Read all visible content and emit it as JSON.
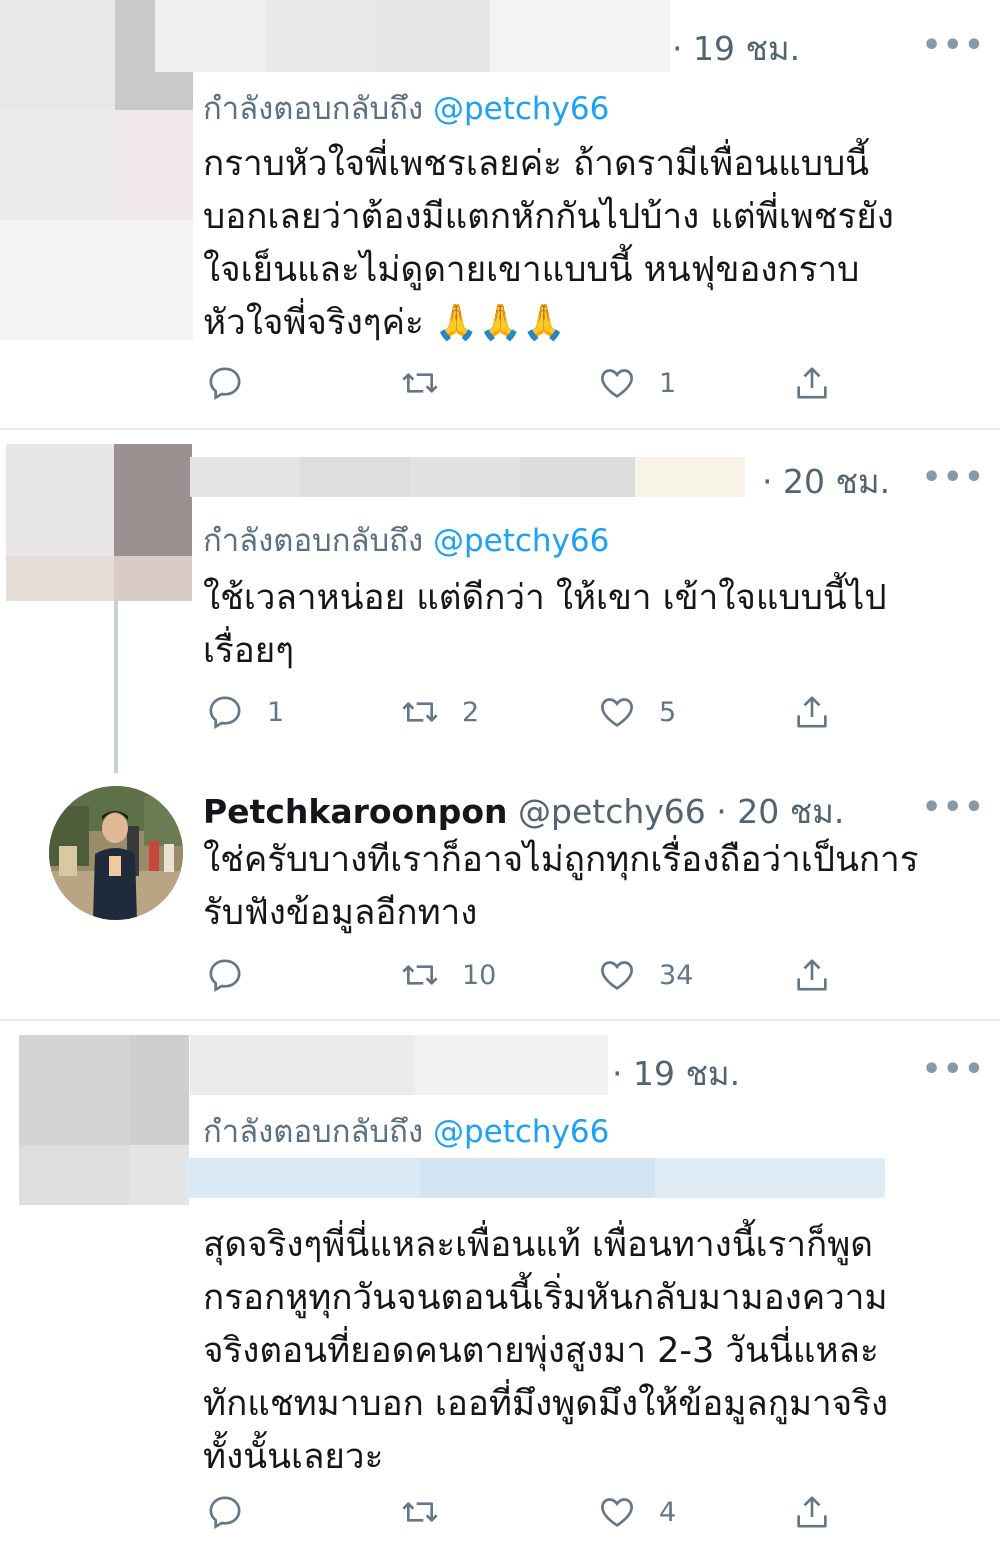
{
  "tweets": [
    {
      "time": "· 19 ชม.",
      "replying_prefix": "กำลังตอบกลับถึง",
      "replying_handle": "@petchy66",
      "lines": [
        "กราบหัวใจพี่เพชรเลยค่ะ ถ้าดรามีเพื่อนแบบนี้",
        "บอกเลยว่าต้องมีแตกหักกันไปบ้าง แต่พี่เพชรยัง",
        "ใจเย็นและไม่ดูดายเขาแบบนี้ หนฟุของกราบ",
        "หัวใจพี่จริงๆค่ะ 🙏🙏🙏"
      ],
      "reply_count": "",
      "retweet_count": "",
      "like_count": "1"
    },
    {
      "time": "· 20 ชม.",
      "replying_prefix": "กำลังตอบกลับถึง",
      "replying_handle": "@petchy66",
      "lines": [
        "ใช้เวลาหน่อย แต่ดีกว่า ให้เขา เข้าใจแบบนี้ไป",
        "เรื่อยๆ"
      ],
      "reply_count": "1",
      "retweet_count": "2",
      "like_count": "5"
    },
    {
      "name": "Petchkaroonpon",
      "handle": "@petchy66",
      "time": "· 20 ชม.",
      "lines": [
        "ใช่ครับบางทีเราก็อาจไม่ถูกทุกเรื่องถือว่าเป็นการ",
        "รับฟังข้อมูลอีกทาง"
      ],
      "reply_count": "",
      "retweet_count": "10",
      "like_count": "34"
    },
    {
      "time": "· 19 ชม.",
      "replying_prefix": "กำลังตอบกลับถึง",
      "replying_handle": "@petchy66",
      "lines": [
        "สุดจริงๆพี่นี่แหละเพื่อนแท้ เพื่อนทางนี้เราก็พูด",
        "กรอกหูทุกวันจนตอนนี้เริ่มหันกลับมามองความ",
        "จริงตอนที่ยอดคนตายพุ่งสูงมา 2-3 วันนี่แหละ",
        "ทักแชทมาบอก เออที่มึงพูดมึงให้ข้อมูลกูมาจริง",
        "ทั้งนั้นเลยวะ"
      ],
      "reply_count": "",
      "retweet_count": "",
      "like_count": "4"
    }
  ],
  "icons": {
    "reply": "reply-icon",
    "retweet": "retweet-icon",
    "like": "heart-icon",
    "share": "share-icon",
    "more": "more-icon"
  },
  "more_glyph": "•••",
  "colors": {
    "text": "#14171a",
    "secondary": "#657786",
    "link": "#1da1f2",
    "divider": "#e6ecf0"
  }
}
